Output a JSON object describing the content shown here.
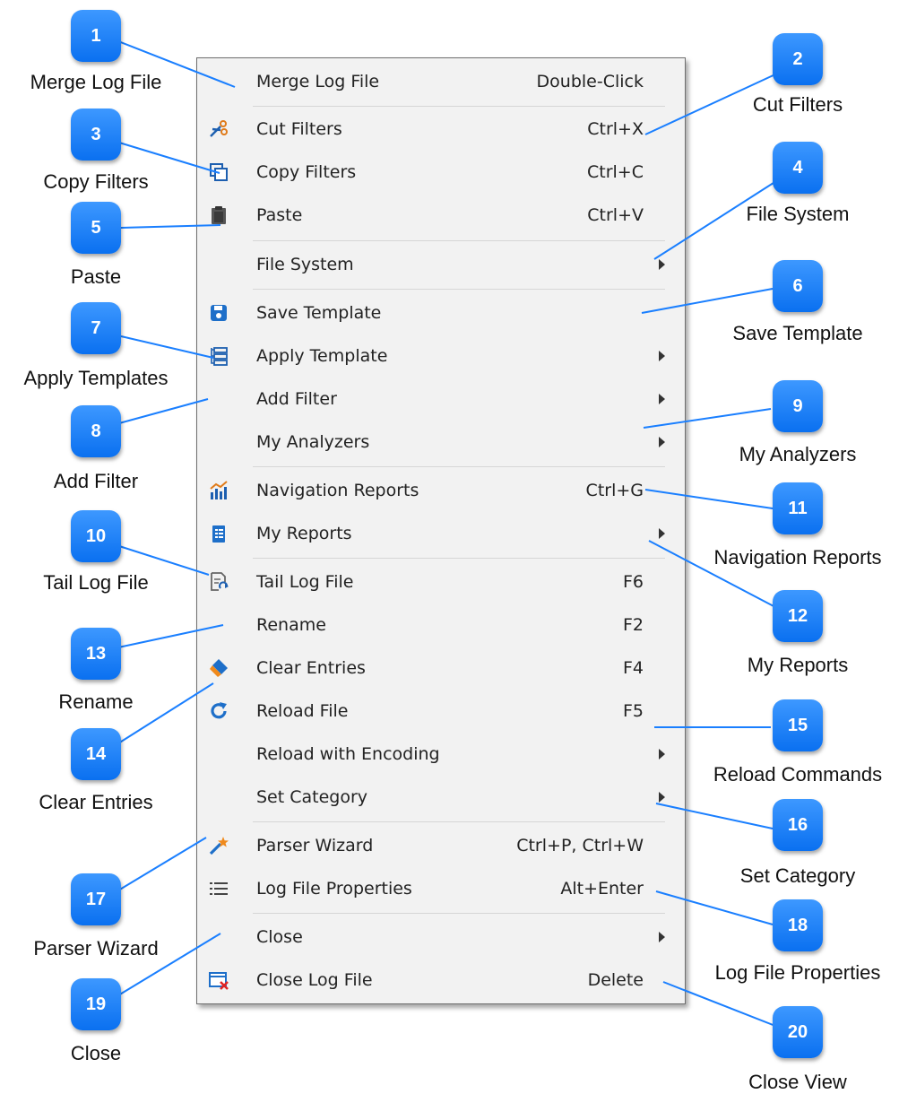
{
  "colors": {
    "badge": "#1a7fff",
    "leader_line": "#1a7fff",
    "menu_background": "#f2f2f2"
  },
  "menu": {
    "items": [
      {
        "label": "Merge Log File",
        "shortcut": "Double-Click",
        "icon": ""
      },
      {
        "label": "Cut Filters",
        "shortcut": "Ctrl+X",
        "icon": "scissors-icon"
      },
      {
        "label": "Copy Filters",
        "shortcut": "Ctrl+C",
        "icon": "copy-icon"
      },
      {
        "label": "Paste",
        "shortcut": "Ctrl+V",
        "icon": "clipboard-icon"
      },
      {
        "label": "File System",
        "shortcut": "",
        "icon": "",
        "submenu": true
      },
      {
        "label": "Save Template",
        "shortcut": "",
        "icon": "save-icon"
      },
      {
        "label": "Apply Template",
        "shortcut": "",
        "icon": "template-icon",
        "submenu": true
      },
      {
        "label": "Add Filter",
        "shortcut": "",
        "icon": "",
        "submenu": true
      },
      {
        "label": "My Analyzers",
        "shortcut": "",
        "icon": "",
        "submenu": true
      },
      {
        "label": "Navigation Reports",
        "shortcut": "Ctrl+G",
        "icon": "chart-icon"
      },
      {
        "label": "My Reports",
        "shortcut": "",
        "icon": "report-icon",
        "submenu": true
      },
      {
        "label": "Tail Log File",
        "shortcut": "F6",
        "icon": "tail-file-icon"
      },
      {
        "label": "Rename",
        "shortcut": "F2",
        "icon": ""
      },
      {
        "label": "Clear Entries",
        "shortcut": "F4",
        "icon": "eraser-icon"
      },
      {
        "label": "Reload File",
        "shortcut": "F5",
        "icon": "reload-icon"
      },
      {
        "label": "Reload with Encoding",
        "shortcut": "",
        "icon": "",
        "submenu": true
      },
      {
        "label": "Set Category",
        "shortcut": "",
        "icon": "",
        "submenu": true
      },
      {
        "label": "Parser Wizard",
        "shortcut": "Ctrl+P, Ctrl+W",
        "icon": "wand-icon"
      },
      {
        "label": "Log File Properties",
        "shortcut": "Alt+Enter",
        "icon": "list-icon"
      },
      {
        "label": "Close",
        "shortcut": "",
        "icon": "",
        "submenu": true
      },
      {
        "label": "Close Log File",
        "shortcut": "Delete",
        "icon": "close-file-icon"
      }
    ]
  },
  "callouts": [
    {
      "number": "1",
      "label": "Merge Log File"
    },
    {
      "number": "2",
      "label": "Cut Filters"
    },
    {
      "number": "3",
      "label": "Copy Filters"
    },
    {
      "number": "4",
      "label": "File System"
    },
    {
      "number": "5",
      "label": "Paste"
    },
    {
      "number": "6",
      "label": "Save Template"
    },
    {
      "number": "7",
      "label": "Apply Templates"
    },
    {
      "number": "8",
      "label": "Add Filter"
    },
    {
      "number": "9",
      "label": "My Analyzers"
    },
    {
      "number": "10",
      "label": "Tail Log File"
    },
    {
      "number": "11",
      "label": "Navigation Reports"
    },
    {
      "number": "12",
      "label": "My Reports"
    },
    {
      "number": "13",
      "label": "Rename"
    },
    {
      "number": "14",
      "label": "Clear Entries"
    },
    {
      "number": "15",
      "label": "Reload Commands"
    },
    {
      "number": "16",
      "label": "Set Category"
    },
    {
      "number": "17",
      "label": "Parser Wizard"
    },
    {
      "number": "18",
      "label": "Log File Properties"
    },
    {
      "number": "19",
      "label": "Close"
    },
    {
      "number": "20",
      "label": "Close View"
    }
  ]
}
